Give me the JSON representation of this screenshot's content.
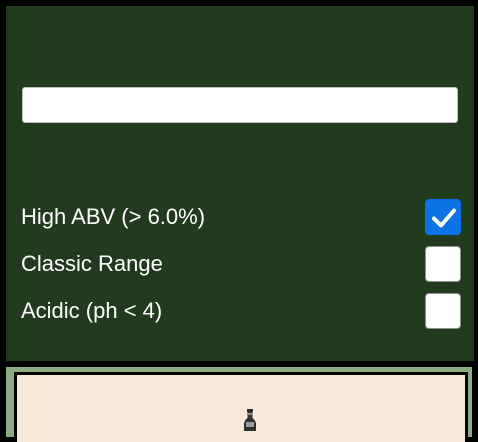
{
  "search": {
    "value": "",
    "placeholder": ""
  },
  "filters": [
    {
      "label": "High ABV (> 6.0%)",
      "checked": true
    },
    {
      "label": "Classic Range",
      "checked": false
    },
    {
      "label": "Acidic (ph < 4)",
      "checked": false
    }
  ],
  "colors": {
    "panel_background": "#223b1e",
    "checkbox_checked": "#0b72e7",
    "card_background": "#f8e9d8",
    "card_frame": "#8cab80"
  },
  "icons": {
    "checkmark": "check-icon",
    "product": "beer-bottle-icon"
  }
}
